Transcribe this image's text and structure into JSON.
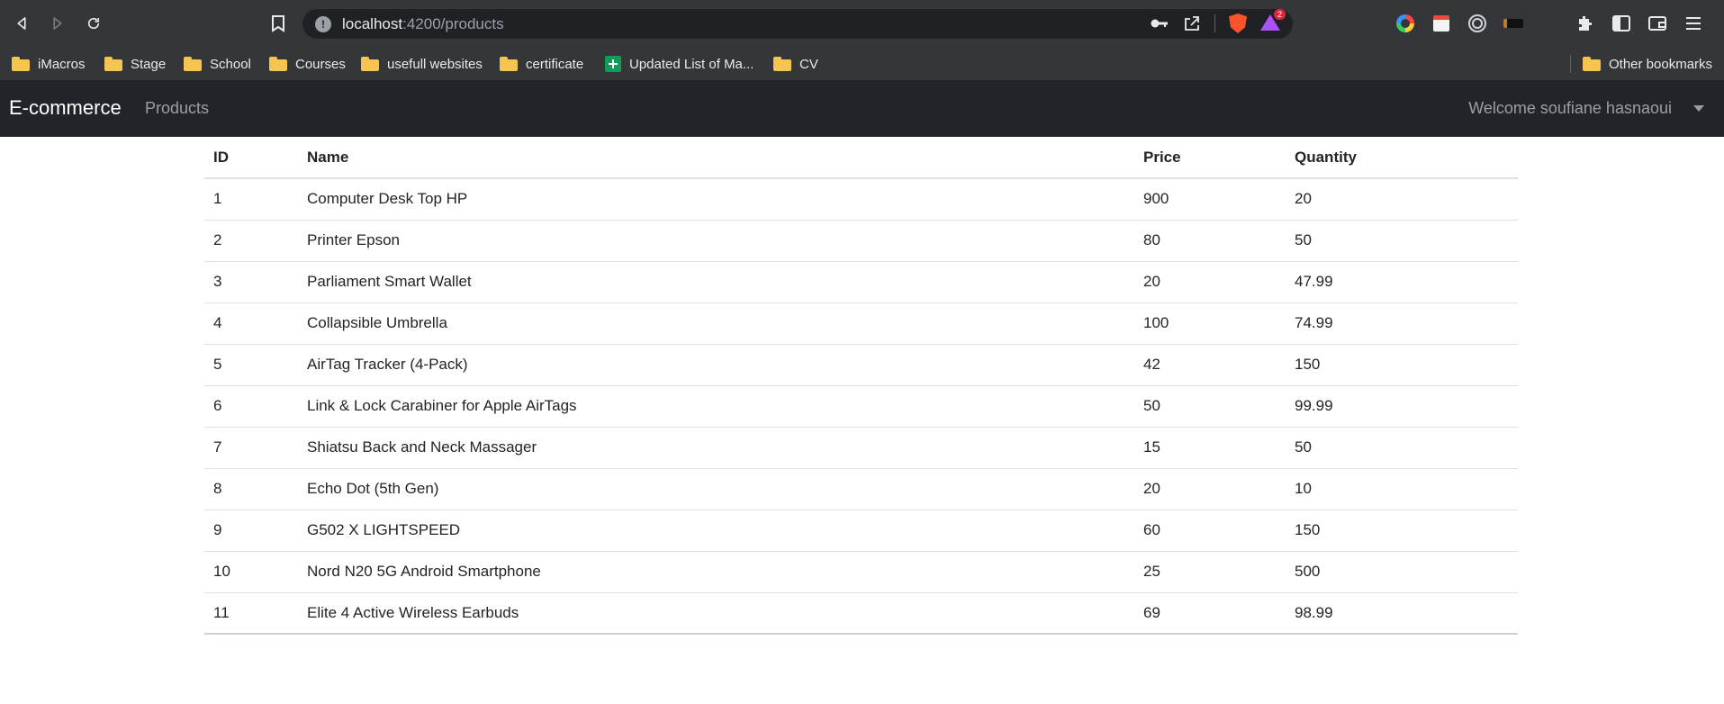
{
  "browser": {
    "url_host": "localhost",
    "url_path": ":4200/products",
    "rewards_badge": "2",
    "bookmarks": [
      {
        "label": "iMacros",
        "icon": "folder-icon"
      },
      {
        "label": "Stage",
        "icon": "folder-icon"
      },
      {
        "label": "School",
        "icon": "folder-icon"
      },
      {
        "label": "Courses",
        "icon": "folder-icon"
      },
      {
        "label": "usefull websites",
        "icon": "folder-icon"
      },
      {
        "label": "certificate",
        "icon": "folder-icon"
      },
      {
        "label": "Updated List of Ma...",
        "icon": "google-sheets-icon"
      },
      {
        "label": "CV",
        "icon": "folder-icon"
      }
    ],
    "other_bookmarks": "Other bookmarks"
  },
  "navbar": {
    "brand": "E-commerce",
    "products_link": "Products",
    "welcome": "Welcome soufiane hasnaoui"
  },
  "table": {
    "headers": [
      "ID",
      "Name",
      "Price",
      "Quantity"
    ],
    "rows": [
      {
        "id": "1",
        "name": "Computer Desk Top HP",
        "price": "900",
        "quantity": "20"
      },
      {
        "id": "2",
        "name": "Printer Epson",
        "price": "80",
        "quantity": "50"
      },
      {
        "id": "3",
        "name": "Parliament Smart Wallet",
        "price": "20",
        "quantity": "47.99"
      },
      {
        "id": "4",
        "name": "Collapsible Umbrella",
        "price": "100",
        "quantity": "74.99"
      },
      {
        "id": "5",
        "name": "AirTag Tracker (4-Pack)",
        "price": "42",
        "quantity": "150"
      },
      {
        "id": "6",
        "name": "Link & Lock Carabiner for Apple AirTags",
        "price": "50",
        "quantity": "99.99"
      },
      {
        "id": "7",
        "name": "Shiatsu Back and Neck Massager",
        "price": "15",
        "quantity": "50"
      },
      {
        "id": "8",
        "name": "Echo Dot (5th Gen)",
        "price": "20",
        "quantity": "10"
      },
      {
        "id": "9",
        "name": "G502 X LIGHTSPEED",
        "price": "60",
        "quantity": "150"
      },
      {
        "id": "10",
        "name": "Nord N20 5G Android Smartphone",
        "price": "25",
        "quantity": "500"
      },
      {
        "id": "11",
        "name": "Elite 4 Active Wireless Earbuds",
        "price": "69",
        "quantity": "98.99"
      }
    ]
  }
}
